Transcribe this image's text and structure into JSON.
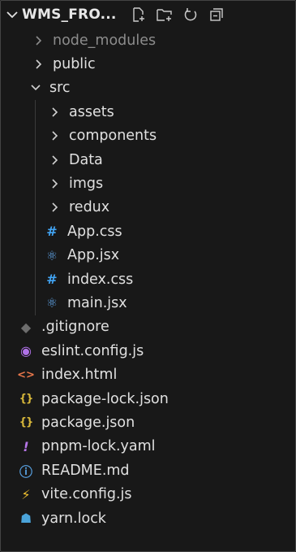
{
  "explorer": {
    "title": "WMS_FRO...",
    "actions": [
      "new-file-icon",
      "new-folder-icon",
      "refresh-icon",
      "collapse-all-icon"
    ]
  },
  "tree": [
    {
      "label": "node_modules",
      "type": "folder",
      "level": 0,
      "expanded": false,
      "dim": true
    },
    {
      "label": "public",
      "type": "folder",
      "level": 0,
      "expanded": false
    },
    {
      "label": "src",
      "type": "folder",
      "level": 0,
      "expanded": true
    },
    {
      "label": "assets",
      "type": "folder",
      "level": 1,
      "expanded": false
    },
    {
      "label": "components",
      "type": "folder",
      "level": 1,
      "expanded": false
    },
    {
      "label": "Data",
      "type": "folder",
      "level": 1,
      "expanded": false
    },
    {
      "label": "imgs",
      "type": "folder",
      "level": 1,
      "expanded": false
    },
    {
      "label": "redux",
      "type": "folder",
      "level": 1,
      "expanded": false
    },
    {
      "label": "App.css",
      "type": "file",
      "level": 1,
      "icon": "css-icon",
      "glyph": "#",
      "color": "#42a5f5"
    },
    {
      "label": "App.jsx",
      "type": "file",
      "level": 1,
      "icon": "react-icon",
      "glyph": "⚛",
      "color": "#5fa3e6"
    },
    {
      "label": "index.css",
      "type": "file",
      "level": 1,
      "icon": "css-icon",
      "glyph": "#",
      "color": "#42a5f5"
    },
    {
      "label": "main.jsx",
      "type": "file",
      "level": 1,
      "icon": "react-icon",
      "glyph": "⚛",
      "color": "#5fa3e6"
    },
    {
      "label": ".gitignore",
      "type": "file",
      "level": 0,
      "icon": "git-icon",
      "glyph": "◆",
      "color": "#6d6d6d"
    },
    {
      "label": "eslint.config.js",
      "type": "file",
      "level": 0,
      "icon": "eslint-icon",
      "glyph": "◉",
      "color": "#b072e8"
    },
    {
      "label": "index.html",
      "type": "file",
      "level": 0,
      "icon": "html-icon",
      "glyph": "<>",
      "color": "#e8774b"
    },
    {
      "label": "package-lock.json",
      "type": "file",
      "level": 0,
      "icon": "json-icon",
      "glyph": "{}",
      "color": "#d7b73a"
    },
    {
      "label": "package.json",
      "type": "file",
      "level": 0,
      "icon": "json-icon",
      "glyph": "{}",
      "color": "#d7b73a"
    },
    {
      "label": "pnpm-lock.yaml",
      "type": "file",
      "level": 0,
      "icon": "yaml-icon",
      "glyph": "!",
      "color": "#b575e6"
    },
    {
      "label": "README.md",
      "type": "file",
      "level": 0,
      "icon": "info-icon",
      "glyph": "ⓘ",
      "color": "#59a4e6"
    },
    {
      "label": "vite.config.js",
      "type": "file",
      "level": 0,
      "icon": "vite-icon",
      "glyph": "⚡",
      "color": "#f2c230"
    },
    {
      "label": "yarn.lock",
      "type": "file",
      "level": 0,
      "icon": "yarn-icon",
      "glyph": "☗",
      "color": "#4aa3d9"
    }
  ]
}
